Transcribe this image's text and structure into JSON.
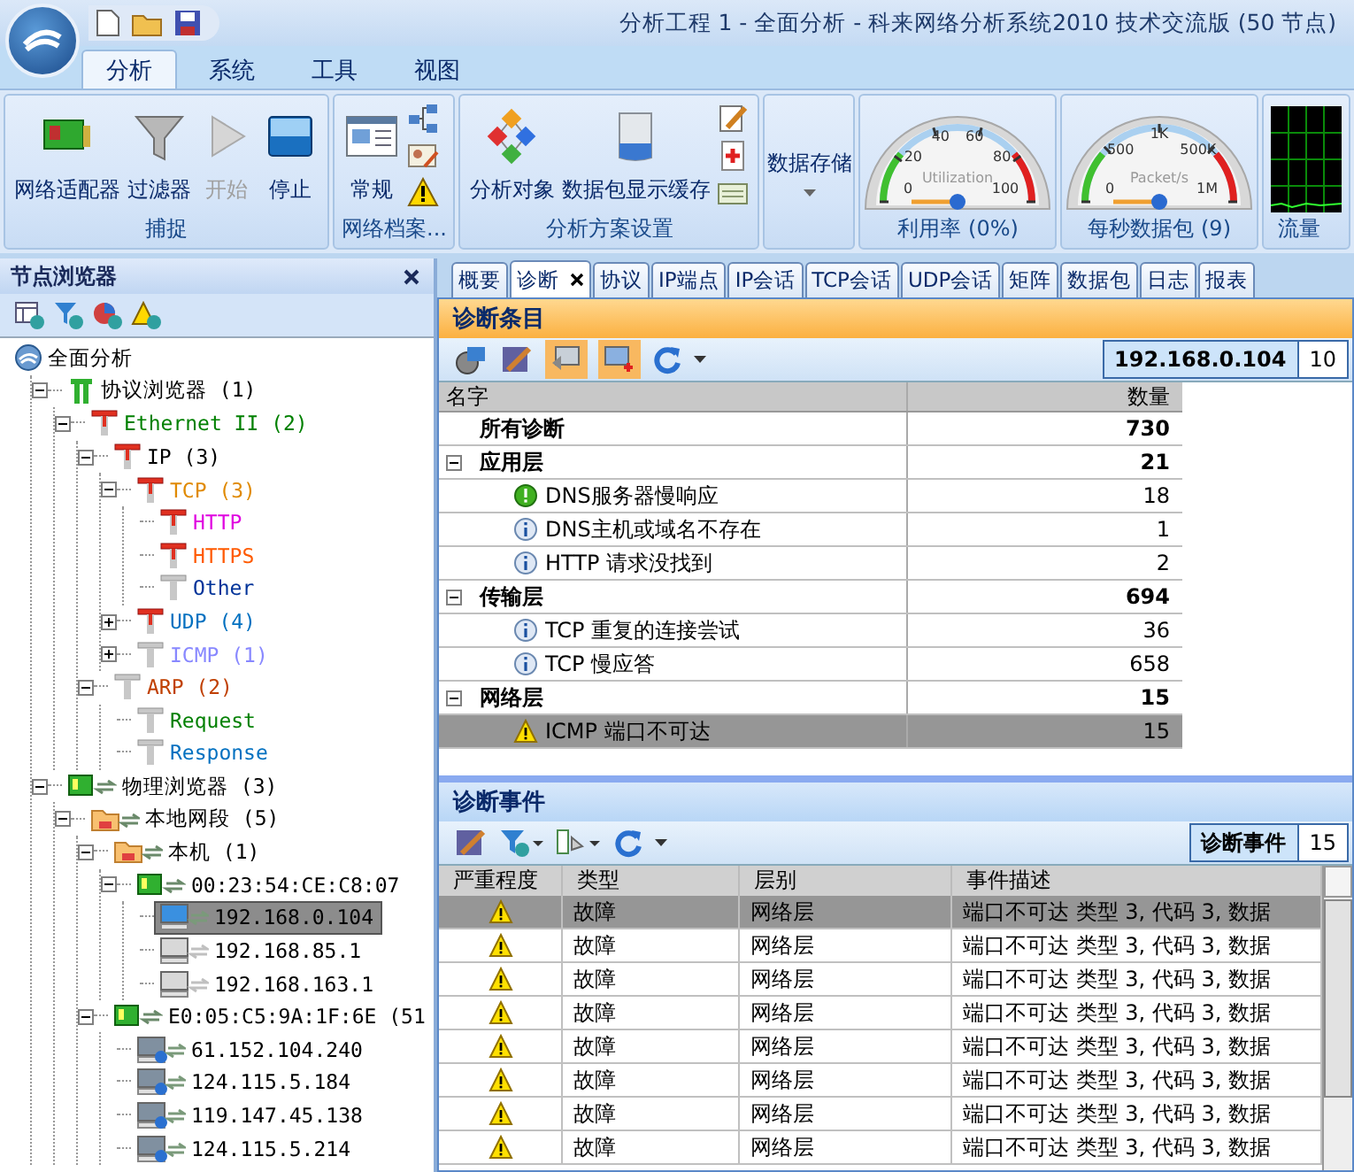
{
  "window": {
    "title": "分析工程 1 - 全面分析 - 科来网络分析系统2010 技术交流版 (50 节点)"
  },
  "ribbon": {
    "tabs": [
      {
        "label": "分析",
        "selected": true
      },
      {
        "label": "系统",
        "selected": false
      },
      {
        "label": "工具",
        "selected": false
      },
      {
        "label": "视图",
        "selected": false
      }
    ],
    "groups": [
      {
        "kind": "buttons",
        "label": "捕捉",
        "buttons": [
          {
            "label": "网络适配器",
            "kind": "adapter",
            "disabled": false
          },
          {
            "label": "过滤器",
            "kind": "filter",
            "disabled": false
          },
          {
            "label": "开始",
            "kind": "play",
            "disabled": true
          },
          {
            "label": "停止",
            "kind": "stop",
            "disabled": false
          }
        ]
      },
      {
        "kind": "buttons",
        "label": "网络档案...",
        "buttons": [
          {
            "label": "常规",
            "kind": "profile",
            "disabled": false
          }
        ]
      },
      {
        "kind": "buttons",
        "label": "分析方案设置",
        "buttons": [
          {
            "label": "分析对象",
            "kind": "objects",
            "disabled": false
          },
          {
            "label": "数据包显示缓存",
            "kind": "buffer",
            "disabled": false
          }
        ]
      },
      {
        "kind": "storage",
        "button": "数据存储"
      },
      {
        "kind": "gauge",
        "label": "利用率 (0%)",
        "caption": "Utilization",
        "scale": [
          "0",
          "20",
          "40",
          "60",
          "80",
          "100"
        ]
      },
      {
        "kind": "gauge",
        "label": "每秒数据包 (9)",
        "caption": "Packet/s",
        "scale": [
          "0",
          "500",
          "1K",
          "500K",
          "1M"
        ]
      },
      {
        "kind": "graph",
        "label": "流量"
      }
    ]
  },
  "node_browser": {
    "title": "节点浏览器",
    "tree": [
      {
        "label": "全面分析",
        "kind": "analysis",
        "selected": false,
        "children": [
          {
            "label": "协议浏览器 (1)",
            "kind": "protocol-browser",
            "expanded": true,
            "selected": false,
            "children": [
              {
                "label": "Ethernet II (2)",
                "kind": "protocol",
                "color": "#008000",
                "expanded": true,
                "selected": false,
                "children": [
                  {
                    "label": "IP (3)",
                    "kind": "protocol",
                    "color": "#000000",
                    "expanded": true,
                    "selected": false,
                    "children": [
                      {
                        "label": "TCP (3)",
                        "kind": "protocol",
                        "color": "#e08a00",
                        "expanded": true,
                        "selected": false,
                        "children": [
                          {
                            "label": "HTTP",
                            "kind": "protocol",
                            "color": "#e000e0",
                            "selected": false
                          },
                          {
                            "label": "HTTPS",
                            "kind": "protocol",
                            "color": "#ff5a00",
                            "selected": false
                          },
                          {
                            "label": "Other",
                            "kind": "protocol-idle",
                            "color": "#003399",
                            "selected": false
                          }
                        ]
                      },
                      {
                        "label": "UDP (4)",
                        "kind": "protocol",
                        "color": "#0070c0",
                        "expanded": false,
                        "selected": false
                      },
                      {
                        "label": "ICMP (1)",
                        "kind": "protocol-idle",
                        "color": "#8888ff",
                        "expanded": false,
                        "selected": false
                      }
                    ]
                  },
                  {
                    "label": "ARP (2)",
                    "kind": "protocol-idle",
                    "color": "#c04000",
                    "expanded": true,
                    "selected": false,
                    "children": [
                      {
                        "label": "Request",
                        "kind": "protocol-idle",
                        "color": "#008000",
                        "selected": false
                      },
                      {
                        "label": "Response",
                        "kind": "protocol-idle",
                        "color": "#0070c0",
                        "selected": false
                      }
                    ]
                  }
                ]
              }
            ]
          },
          {
            "label": "物理浏览器 (3)",
            "kind": "physical-browser",
            "expanded": true,
            "selected": false,
            "children": [
              {
                "label": "本地网段 (5)",
                "kind": "segment",
                "expanded": true,
                "selected": false,
                "children": [
                  {
                    "label": "本机 (1)",
                    "kind": "segment",
                    "expanded": true,
                    "selected": false,
                    "children": [
                      {
                        "label": "00:23:54:CE:C8:07",
                        "kind": "adapter",
                        "expanded": true,
                        "selected": false,
                        "children": [
                          {
                            "label": "192.168.0.104",
                            "kind": "host",
                            "selected": true
                          },
                          {
                            "label": "192.168.85.1",
                            "kind": "host-idle",
                            "selected": false
                          },
                          {
                            "label": "192.168.163.1",
                            "kind": "host-idle",
                            "selected": false
                          }
                        ]
                      }
                    ]
                  },
                  {
                    "label": "E0:05:C5:9A:1F:6E (51",
                    "kind": "adapter",
                    "expanded": true,
                    "selected": false,
                    "children": [
                      {
                        "label": "61.152.104.240",
                        "kind": "remote",
                        "selected": false
                      },
                      {
                        "label": "124.115.5.184",
                        "kind": "remote",
                        "selected": false
                      },
                      {
                        "label": "119.147.45.138",
                        "kind": "remote",
                        "selected": false
                      },
                      {
                        "label": "124.115.5.214",
                        "kind": "remote",
                        "selected": false
                      }
                    ]
                  }
                ]
              }
            ]
          }
        ]
      }
    ]
  },
  "tabs": [
    {
      "label": "概要",
      "selected": false
    },
    {
      "label": "诊断",
      "selected": true
    },
    {
      "label": "协议",
      "selected": false
    },
    {
      "label": "IP端点",
      "selected": false
    },
    {
      "label": "IP会话",
      "selected": false
    },
    {
      "label": "TCP会话",
      "selected": false
    },
    {
      "label": "UDP会话",
      "selected": false
    },
    {
      "label": "矩阵",
      "selected": false
    },
    {
      "label": "数据包",
      "selected": false
    },
    {
      "label": "日志",
      "selected": false
    },
    {
      "label": "报表",
      "selected": false
    }
  ],
  "diagnosis": {
    "title": "诊断条目",
    "node": "192.168.0.104",
    "node_count": "10",
    "columns": [
      "名字",
      "数量"
    ],
    "rows": [
      {
        "kind": "total",
        "name": "所有诊断",
        "count": "730",
        "selected": false
      },
      {
        "kind": "group",
        "name": "应用层",
        "count": "21",
        "expanded": true,
        "selected": false
      },
      {
        "kind": "notice",
        "name": "DNS服务器慢响应",
        "count": "18",
        "selected": false
      },
      {
        "kind": "info",
        "name": "DNS主机或域名不存在",
        "count": "1",
        "selected": false
      },
      {
        "kind": "info",
        "name": "HTTP 请求没找到",
        "count": "2",
        "selected": false
      },
      {
        "kind": "group",
        "name": "传输层",
        "count": "694",
        "expanded": true,
        "selected": false
      },
      {
        "kind": "info",
        "name": "TCP 重复的连接尝试",
        "count": "36",
        "selected": false
      },
      {
        "kind": "info",
        "name": "TCP 慢应答",
        "count": "658",
        "selected": false
      },
      {
        "kind": "group",
        "name": "网络层",
        "count": "15",
        "expanded": true,
        "selected": false
      },
      {
        "kind": "warning",
        "name": "ICMP 端口不可达",
        "count": "15",
        "selected": true
      }
    ]
  },
  "events": {
    "title": "诊断事件",
    "counter_label": "诊断事件",
    "counter_value": "15",
    "columns": [
      "严重程度",
      "类型",
      "层别",
      "事件描述"
    ],
    "rows": [
      {
        "kind": "warning",
        "type": "故障",
        "layer": "网络层",
        "description": "端口不可达 类型 3, 代码 3, 数据",
        "selected": true
      },
      {
        "kind": "warning",
        "type": "故障",
        "layer": "网络层",
        "description": "端口不可达 类型 3, 代码 3, 数据",
        "selected": false
      },
      {
        "kind": "warning",
        "type": "故障",
        "layer": "网络层",
        "description": "端口不可达 类型 3, 代码 3, 数据",
        "selected": false
      },
      {
        "kind": "warning",
        "type": "故障",
        "layer": "网络层",
        "description": "端口不可达 类型 3, 代码 3, 数据",
        "selected": false
      },
      {
        "kind": "warning",
        "type": "故障",
        "layer": "网络层",
        "description": "端口不可达 类型 3, 代码 3, 数据",
        "selected": false
      },
      {
        "kind": "warning",
        "type": "故障",
        "layer": "网络层",
        "description": "端口不可达 类型 3, 代码 3, 数据",
        "selected": false
      },
      {
        "kind": "warning",
        "type": "故障",
        "layer": "网络层",
        "description": "端口不可达 类型 3, 代码 3, 数据",
        "selected": false
      },
      {
        "kind": "warning",
        "type": "故障",
        "layer": "网络层",
        "description": "端口不可达 类型 3, 代码 3, 数据",
        "selected": false
      }
    ]
  }
}
